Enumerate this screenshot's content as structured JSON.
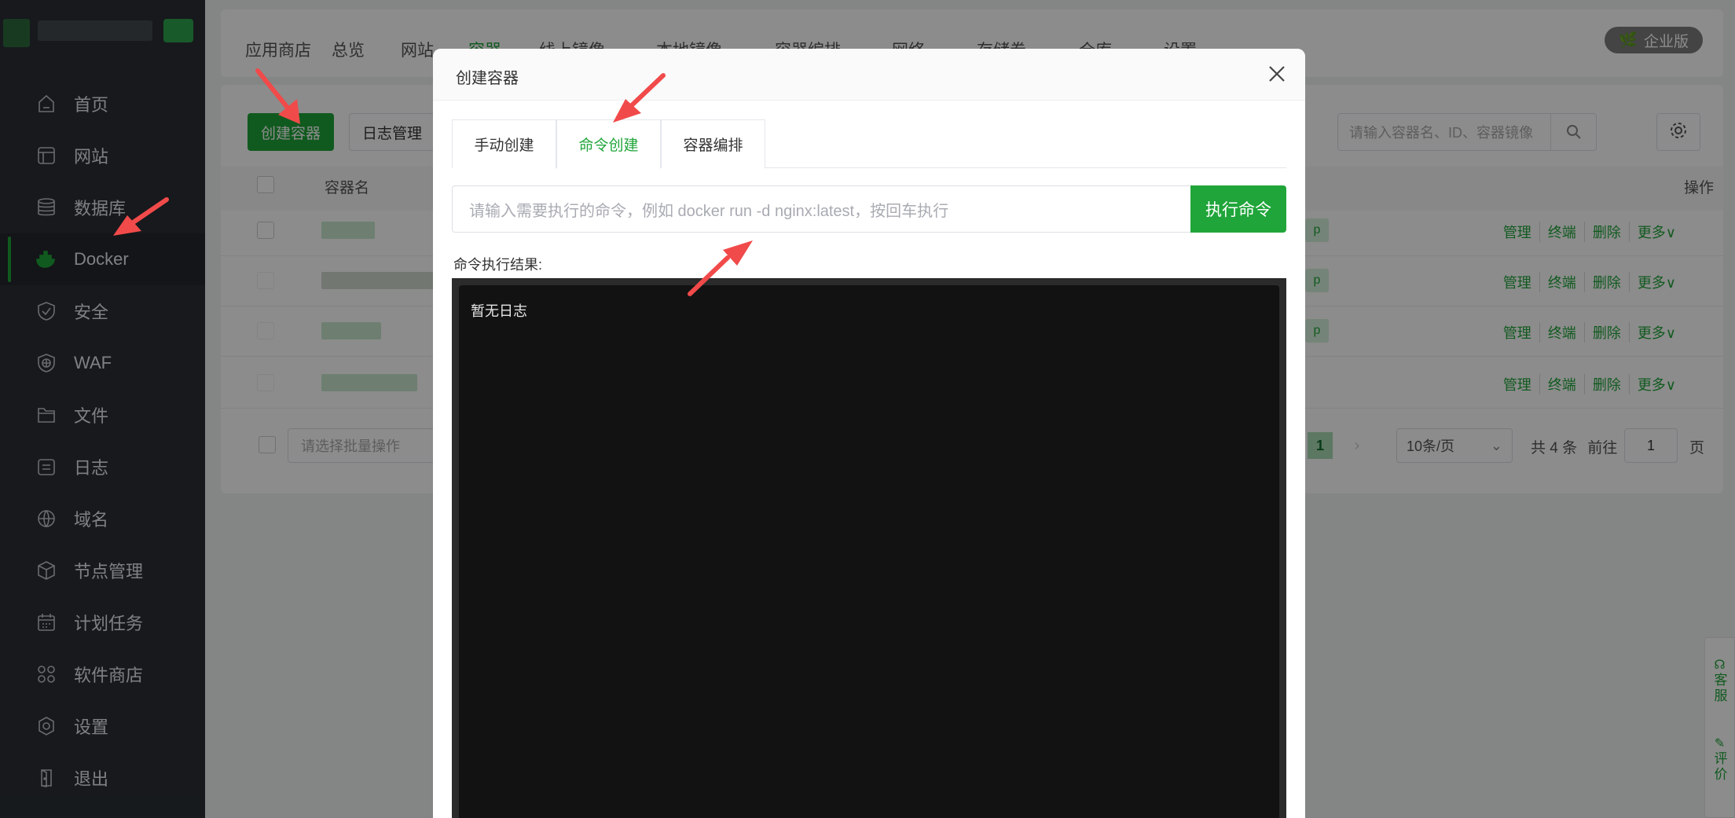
{
  "sidebar": {
    "items": [
      {
        "label": "首页",
        "icon": "home-icon"
      },
      {
        "label": "网站",
        "icon": "website-icon"
      },
      {
        "label": "数据库",
        "icon": "database-icon"
      },
      {
        "label": "Docker",
        "icon": "docker-icon",
        "active": true
      },
      {
        "label": "安全",
        "icon": "shield-icon"
      },
      {
        "label": "WAF",
        "icon": "waf-icon"
      },
      {
        "label": "文件",
        "icon": "folder-icon"
      },
      {
        "label": "日志",
        "icon": "log-icon"
      },
      {
        "label": "域名",
        "icon": "www-icon"
      },
      {
        "label": "节点管理",
        "icon": "cube-icon"
      },
      {
        "label": "计划任务",
        "icon": "calendar-icon"
      },
      {
        "label": "软件商店",
        "icon": "apps-icon"
      },
      {
        "label": "设置",
        "icon": "settings-icon"
      },
      {
        "label": "退出",
        "icon": "logout-icon"
      }
    ]
  },
  "top_tabs": [
    "应用商店",
    "总览",
    "网站",
    "容器",
    "线上镜像",
    "本地镜像",
    "容器编排",
    "网络",
    "存储卷",
    "仓库",
    "设置"
  ],
  "active_top_tab": "容器",
  "enterprise_badge": "企业版",
  "toolbar": {
    "create_label": "创建容器",
    "log_label": "日志管理",
    "search_placeholder": "请输入容器名、ID、容器镜像"
  },
  "table": {
    "col_name": "容器名",
    "col_ops": "操作",
    "row_tag": "p",
    "row_ops": [
      "管理",
      "终端",
      "删除",
      "更多∨"
    ]
  },
  "pagination": {
    "batch_placeholder": "请选择批量操作",
    "current_page": "1",
    "page_size": "10条/页",
    "total": "共 4 条",
    "goto_label": "前往",
    "goto_value": "1",
    "page_unit": "页"
  },
  "float_bar": {
    "service": "客服",
    "review": "评价"
  },
  "modal": {
    "title": "创建容器",
    "tabs": [
      "手动创建",
      "命令创建",
      "容器编排"
    ],
    "active_tab": "命令创建",
    "cmd_placeholder": "请输入需要执行的命令，例如 docker run -d nginx:latest，按回车执行",
    "cmd_button": "执行命令",
    "result_label": "命令执行结果:",
    "terminal_text": "暂无日志"
  },
  "colors": {
    "accent": "#20a53a",
    "sidebar_bg": "#2a2f35",
    "annotation_arrow": "#f14a4a"
  }
}
